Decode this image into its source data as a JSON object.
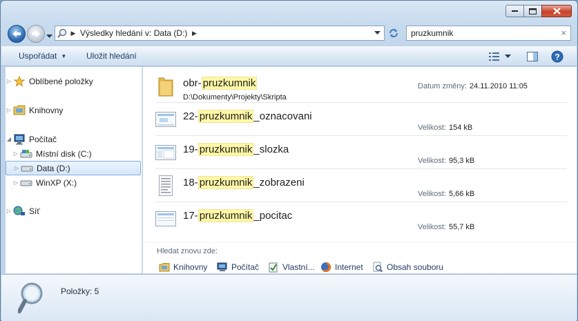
{
  "window": {
    "colors": {
      "accent": "#3a6ea5",
      "highlight": "#fff8a6",
      "close": "#c7432c"
    }
  },
  "address": {
    "text": "Výsledky hledání v: Data (D:)"
  },
  "search": {
    "value": "pruzkumnik",
    "clear_icon": "×"
  },
  "toolbar": {
    "organize_label": "Uspořádat",
    "save_search_label": "Uložit hledání"
  },
  "nav": {
    "favorites": "Oblíbené položky",
    "libraries": "Knihovny",
    "computer": "Počítač",
    "drives": [
      {
        "label": "Místní disk (C:)"
      },
      {
        "label": "Data (D:)",
        "selected": true
      },
      {
        "label": "WinXP (X:)"
      }
    ],
    "network": "Síť"
  },
  "results": [
    {
      "prefix": "obr-",
      "match": "pruzkumnik",
      "suffix": "",
      "path": "D:\\Dokumenty\\Projekty\\Skripta",
      "meta_key": "Datum změny:",
      "meta_value": "24.11.2010 11:05",
      "icon": "folder-icon"
    },
    {
      "prefix": "22-",
      "match": "pruzkumnik",
      "suffix": "_oznacovani",
      "meta_key": "Velikost:",
      "meta_value": "154 kB",
      "icon": "image-file-icon"
    },
    {
      "prefix": "19-",
      "match": "pruzkumnik",
      "suffix": "_slozka",
      "meta_key": "Velikost:",
      "meta_value": "95,3 kB",
      "icon": "image-file-icon"
    },
    {
      "prefix": "18-",
      "match": "pruzkumnik",
      "suffix": "_zobrazeni",
      "meta_key": "Velikost:",
      "meta_value": "5,66 kB",
      "icon": "document-file-icon"
    },
    {
      "prefix": "17-",
      "match": "pruzkumnik",
      "suffix": "_pocitac",
      "meta_key": "Velikost:",
      "meta_value": "55,7 kB",
      "icon": "image-file-icon"
    }
  ],
  "search_again": {
    "label": "Hledat znovu zde:",
    "links": [
      "Knihovny",
      "Počítač",
      "Vlastní...",
      "Internet",
      "Obsah souboru"
    ]
  },
  "details": {
    "count_text": "Položky: 5"
  }
}
